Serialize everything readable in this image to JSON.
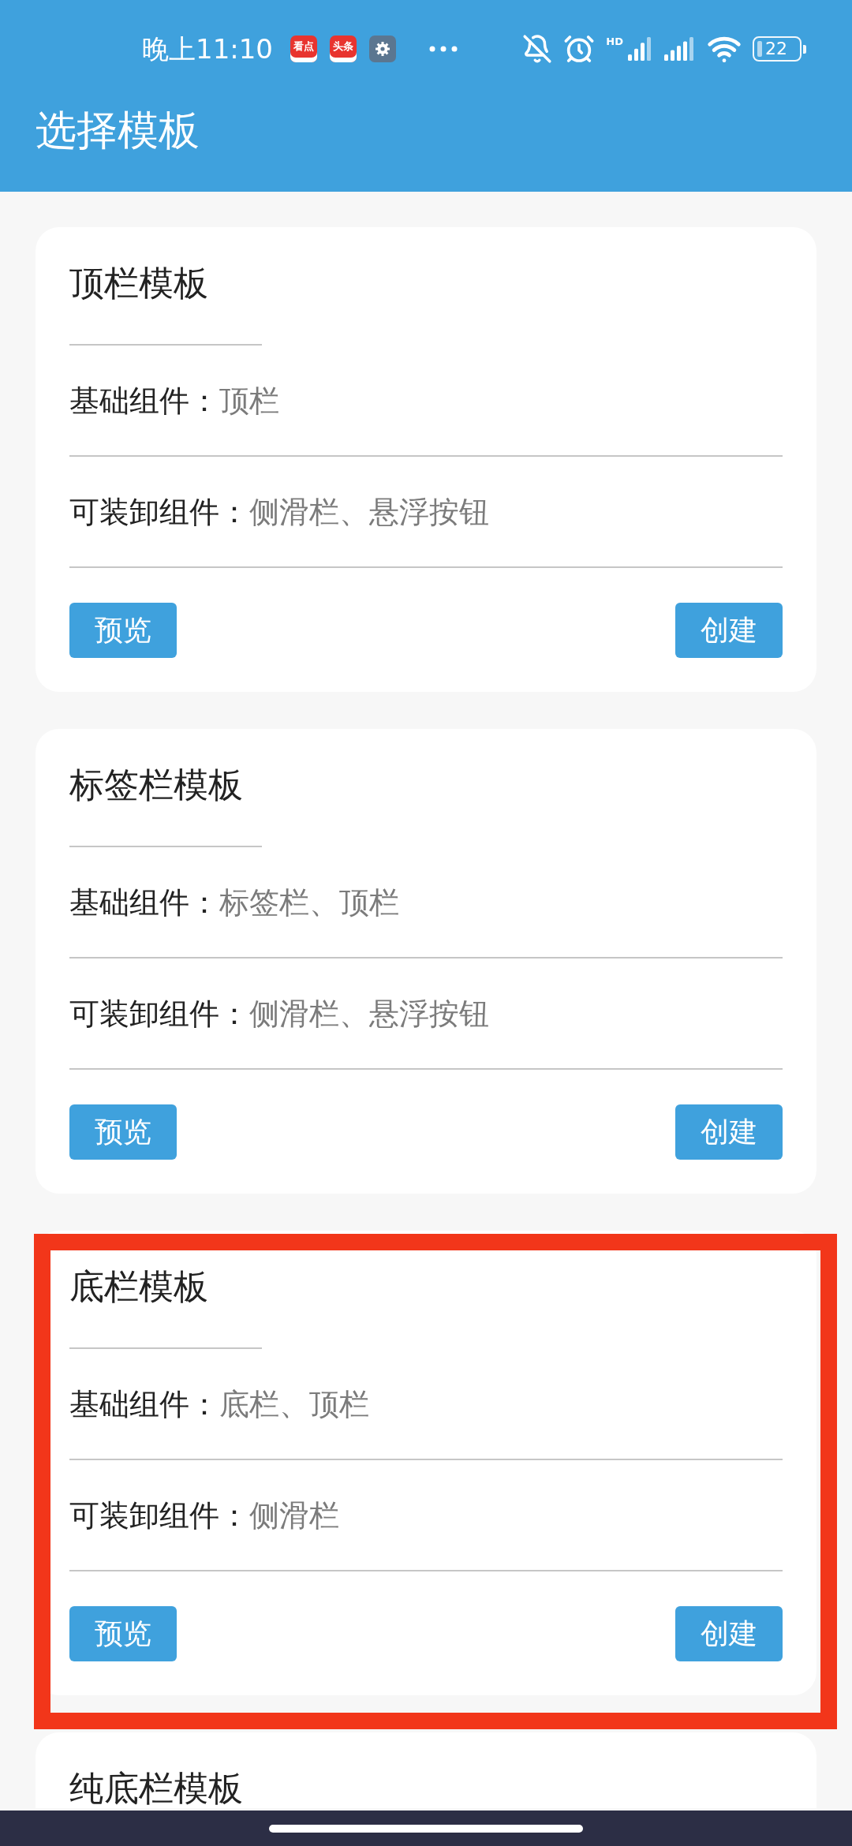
{
  "status_bar": {
    "time": "晚上11:10",
    "notifications": [
      {
        "kind": "app",
        "label": "看点"
      },
      {
        "kind": "app",
        "label": "头条"
      },
      {
        "kind": "settings"
      }
    ],
    "network_label": "HD",
    "battery": "22"
  },
  "toolbar": {
    "title": "选择模板"
  },
  "templates": [
    {
      "title": "顶栏模板",
      "rows": [
        {
          "label": "基础组件：",
          "value": "顶栏"
        },
        {
          "label": "可装卸组件：",
          "value": "侧滑栏、悬浮按钮"
        }
      ],
      "buttons": [
        "预览",
        "创建"
      ],
      "highlighted": false
    },
    {
      "title": "标签栏模板",
      "rows": [
        {
          "label": "基础组件：",
          "value": "标签栏、顶栏"
        },
        {
          "label": "可装卸组件：",
          "value": "侧滑栏、悬浮按钮"
        }
      ],
      "buttons": [
        "预览",
        "创建"
      ],
      "highlighted": false
    },
    {
      "title": "底栏模板",
      "rows": [
        {
          "label": "基础组件：",
          "value": "底栏、顶栏"
        },
        {
          "label": "可装卸组件：",
          "value": "侧滑栏"
        }
      ],
      "buttons": [
        "预览",
        "创建"
      ],
      "highlighted": true
    },
    {
      "title": "纯底栏模板",
      "highlighted": false
    }
  ]
}
